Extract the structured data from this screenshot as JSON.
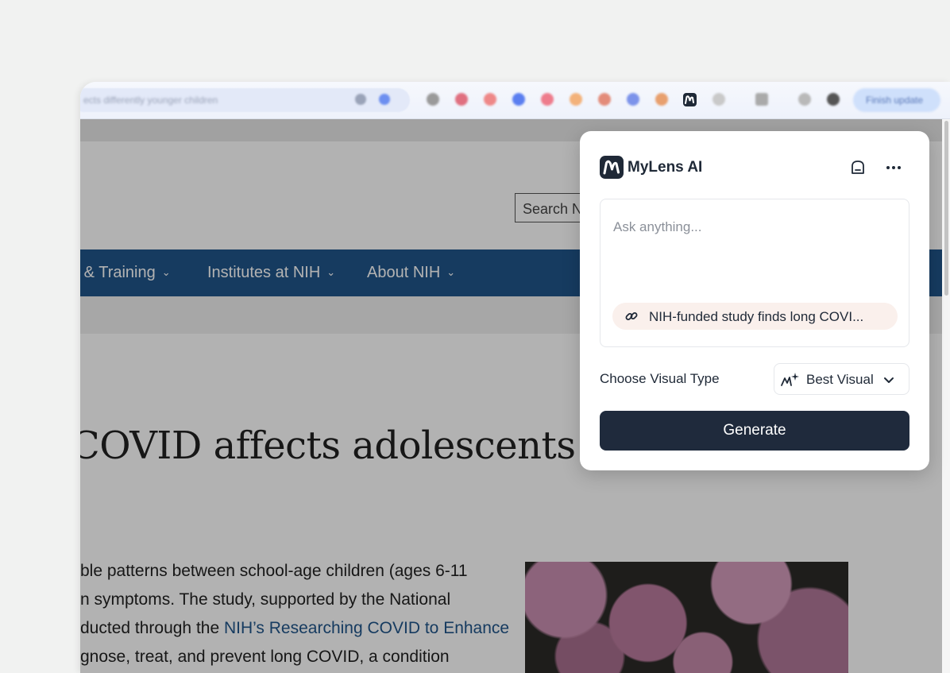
{
  "browser": {
    "address_text": "ects differently younger children",
    "finish_update_label": "Finish update"
  },
  "page": {
    "search_placeholder": "Search N",
    "nav_items": [
      {
        "label": "n & Training"
      },
      {
        "label": "Institutes at NIH"
      },
      {
        "label": "About NIH"
      }
    ],
    "nav_chevron": "⌄",
    "headline": "COVID affects adolescents di",
    "body_lines": [
      {
        "text": "ble patterns between school-age children (ages 6-11"
      },
      {
        "text": "n symptoms. The study, supported by the National"
      },
      {
        "before": "ducted through the ",
        "link": "NIH’s Researching COVID to Enhance"
      },
      {
        "text": "gnose, treat, and prevent long COVID, a condition"
      }
    ]
  },
  "panel": {
    "brand": "MyLens AI",
    "prompt_placeholder": "Ask anything...",
    "context_chip": "NIH-funded study finds long COVI...",
    "visual_type_label": "Choose Visual Type",
    "visual_type_value": "Best Visual",
    "generate_label": "Generate",
    "icons": {
      "header_left": "panel-icon",
      "header_right": "more-icon",
      "chip": "link-icon",
      "visual": "sparkle-chart-icon"
    },
    "colors": {
      "primary": "#1f2a3c",
      "chip_bg": "#faf0ec",
      "nav_blue": "#20558a"
    }
  }
}
